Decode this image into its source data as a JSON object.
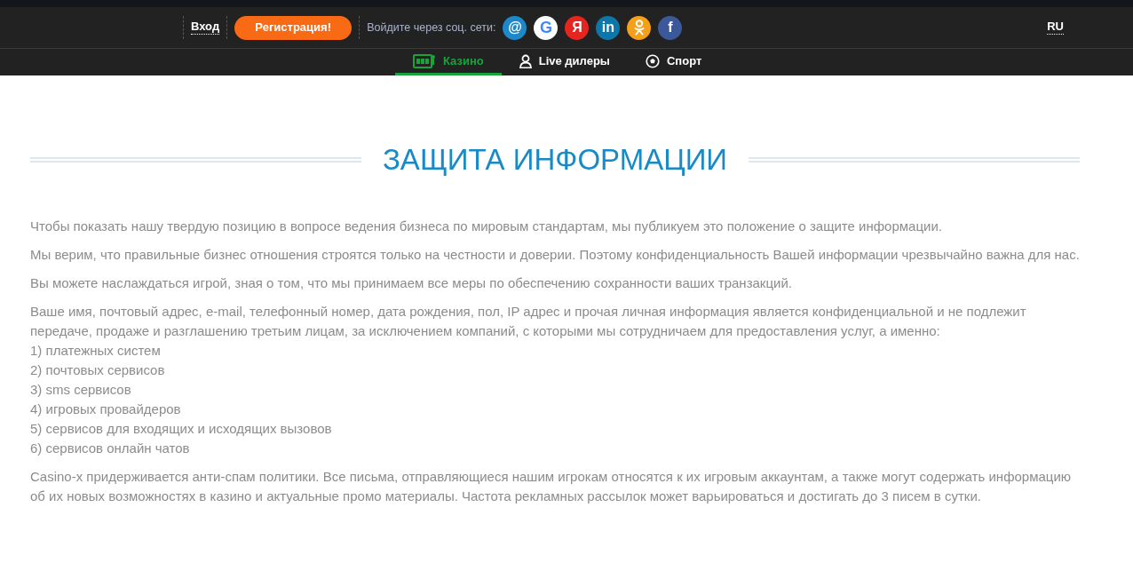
{
  "header": {
    "login": "Вход",
    "register": "Регистрация!",
    "social_label": "Войдите через соц. сети:",
    "social": [
      {
        "kind": "glyph",
        "glyph": "@",
        "color": "#1e88c8"
      },
      {
        "kind": "glyph",
        "glyph": "G",
        "color": "#ffffff"
      },
      {
        "kind": "glyph",
        "glyph": "Я",
        "color": "#e52620"
      },
      {
        "kind": "glyph",
        "glyph": "in",
        "color": "#0e76a8"
      },
      {
        "kind": "ok",
        "color": "#f5a01a"
      },
      {
        "kind": "glyph",
        "glyph": "f",
        "color": "#3b5998"
      }
    ],
    "language": "RU"
  },
  "nav": [
    {
      "label": "Казино",
      "kind": "slot",
      "selected": true
    },
    {
      "label": "Live дилеры",
      "kind": "person",
      "selected": false
    },
    {
      "label": "Спорт",
      "kind": "ball",
      "selected": false
    }
  ],
  "title": "ЗАЩИТА ИНФОРМАЦИИ",
  "content": [
    {
      "text": "Чтобы показать нашу твердую позицию в вопросе ведения бизнеса по мировым стандартам, мы публикуем это положение о защите информации."
    },
    {
      "text": "Мы верим, что правильные бизнес отношения строятся только на честности и доверии. Поэтому конфиденциальность Вашей информации чрезвычайно важна для нас."
    },
    {
      "text": "Вы можете наслаждаться игрой, зная о том, что мы принимаем все меры по обеспечению сохранности ваших транзакций."
    },
    {
      "text": "Ваше имя, почтовый адрес, e-mail, телефонный номер, дата рождения, пол, IP адрес и прочая личная информация является конфиденциальной и не подлежит передаче, продаже и разглашению третьим лицам, за исключением компаний, с которыми мы сотрудничаем для предоставления услуг, а именно:",
      "list": [
        "1) платежных систем",
        "2) почтовых сервисов",
        "3) sms сервисов",
        "4) игровых провайдеров",
        "5) сервисов для входящих и исходящих вызовов",
        "6) сервисов онлайн чатов"
      ]
    },
    {
      "text": "Casino-x придерживается анти-спам политики. Все письма, отправляющиеся нашим игрокам относятся к их игровым аккаунтам, а также могут содержать информацию об их новых возможностях в казино и актуальные промо материалы. Частота рекламных рассылок может варьироваться и достигать до 3 писем в сутки."
    }
  ]
}
